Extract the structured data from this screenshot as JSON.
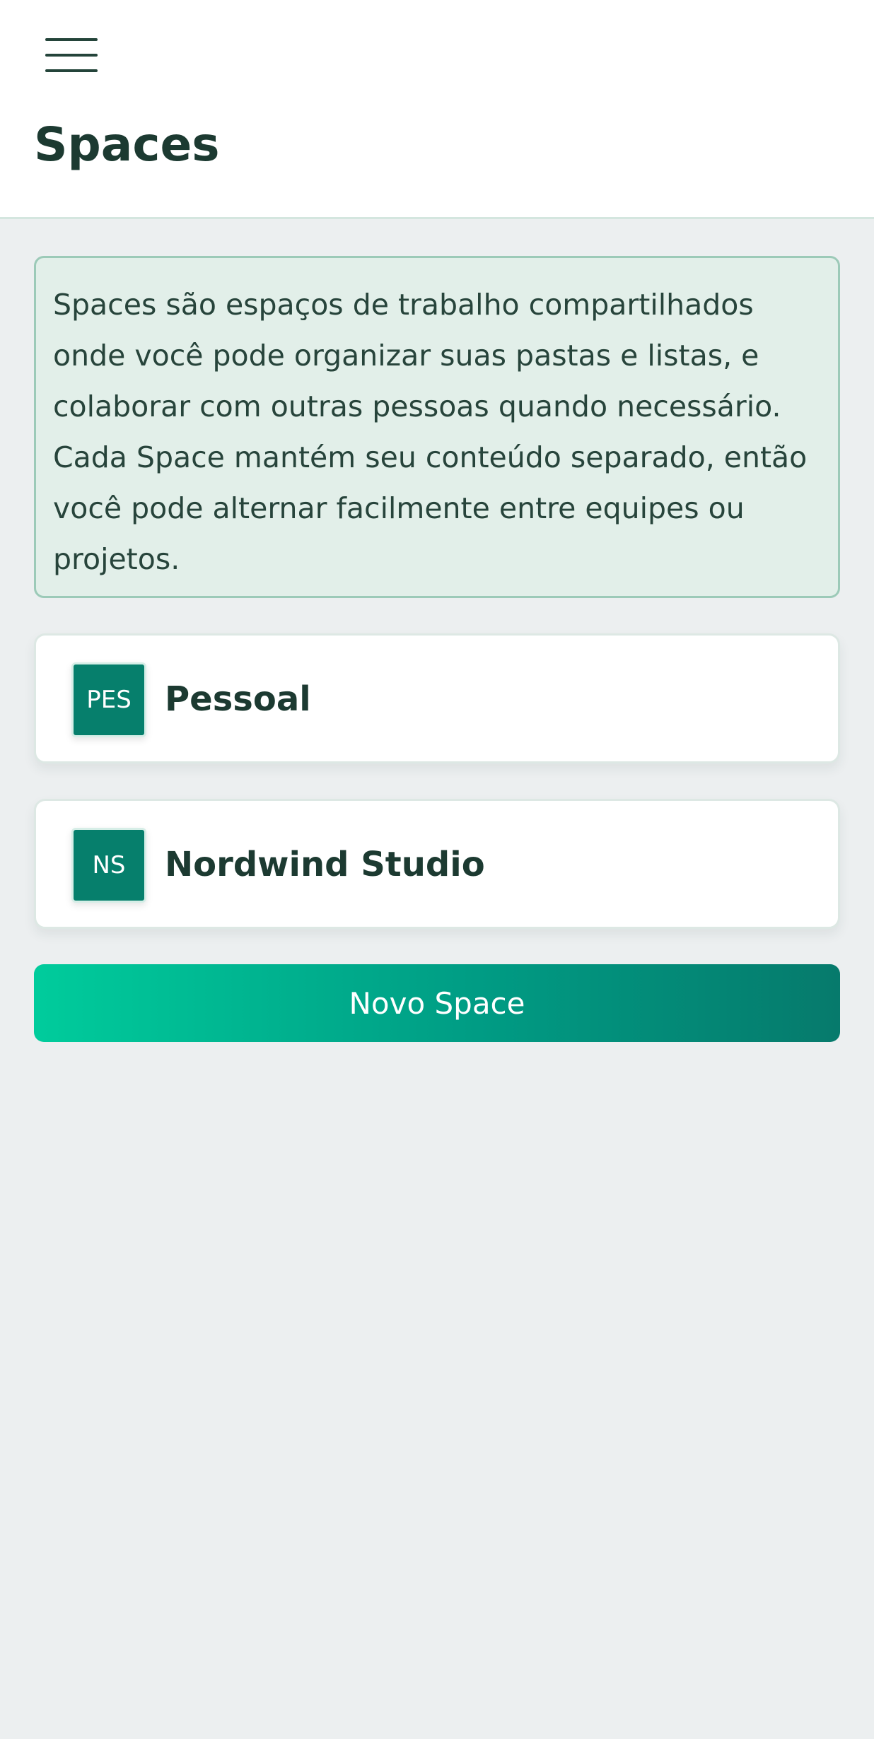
{
  "header": {
    "menu_icon": "hamburger-menu-icon",
    "title": "Spaces"
  },
  "info": {
    "text": "Spaces são espaços de trabalho compartilhados onde você pode organizar suas pastas e listas, e colaborar com outras pessoas quando necessário. Cada Space mantém seu conteúdo separado, então você pode alternar facilmente entre equipes ou projetos."
  },
  "spaces": [
    {
      "initials": "PES",
      "name": "Pessoal"
    },
    {
      "initials": "NS",
      "name": "Nordwind Studio"
    }
  ],
  "actions": {
    "new_space_label": "Novo Space"
  },
  "colors": {
    "accent": "#067f6c",
    "gradient_start": "#00cc9c",
    "gradient_end": "#067a6c",
    "title_text": "#1c3a31",
    "info_background": "#e2efe9",
    "page_background": "#eceff0"
  }
}
